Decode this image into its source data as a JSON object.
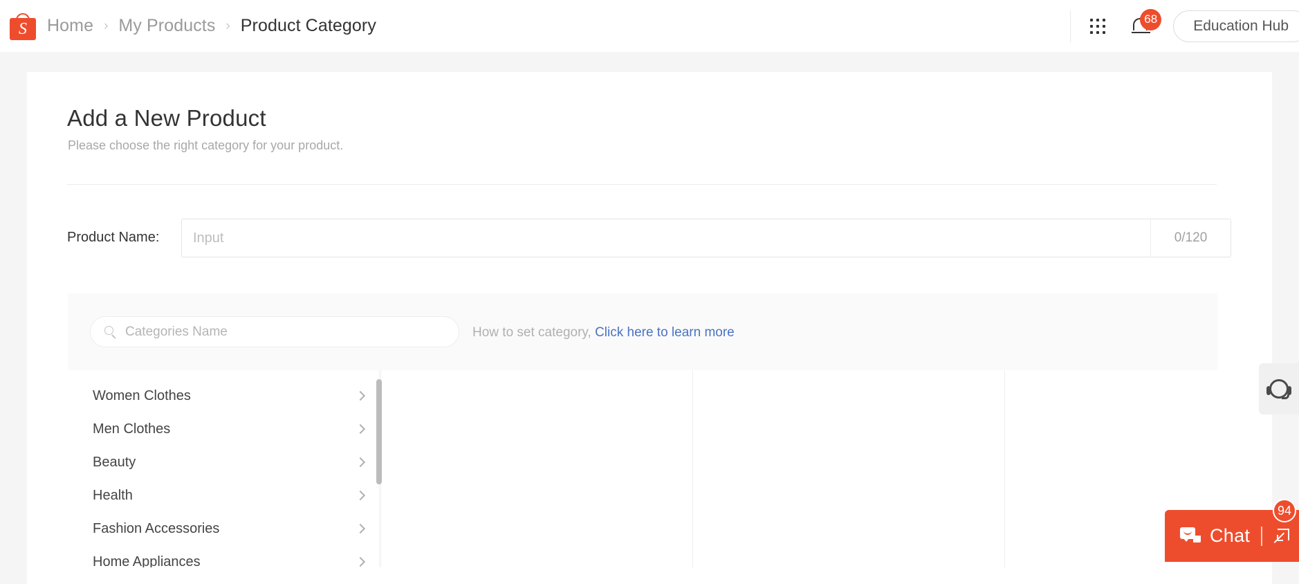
{
  "topbar": {
    "logo_letter": "S",
    "breadcrumb": [
      {
        "label": "Home",
        "current": false
      },
      {
        "label": "My Products",
        "current": false
      },
      {
        "label": "Product Category",
        "current": true
      }
    ],
    "separator": "›",
    "grid_icon": "apps-grid-icon",
    "bell_icon": "notification-bell-icon",
    "notification_count": "68",
    "education_hub_label": "Education Hub"
  },
  "page": {
    "title": "Add a New Product",
    "subtitle": "Please choose the right category for your product."
  },
  "product_name": {
    "label": "Product Name:",
    "value": "",
    "placeholder": "Input",
    "counter": "0/120"
  },
  "category": {
    "search_placeholder": "Categories Name",
    "search_value": "",
    "search_icon": "search-icon",
    "hint_text": "How to set category, ",
    "hint_link": "Click here to learn more",
    "hint_link_color": "#4a72c4",
    "items": [
      {
        "label": "Women Clothes"
      },
      {
        "label": "Men Clothes"
      },
      {
        "label": "Beauty"
      },
      {
        "label": "Health"
      },
      {
        "label": "Fashion Accessories"
      },
      {
        "label": "Home Appliances"
      }
    ]
  },
  "support": {
    "icon": "headset-support-icon"
  },
  "chat": {
    "label": "Chat",
    "badge": "94",
    "icon": "chat-bubble-icon",
    "expand_icon": "expand-arrow-icon",
    "accent_color": "#ee4d2d"
  }
}
